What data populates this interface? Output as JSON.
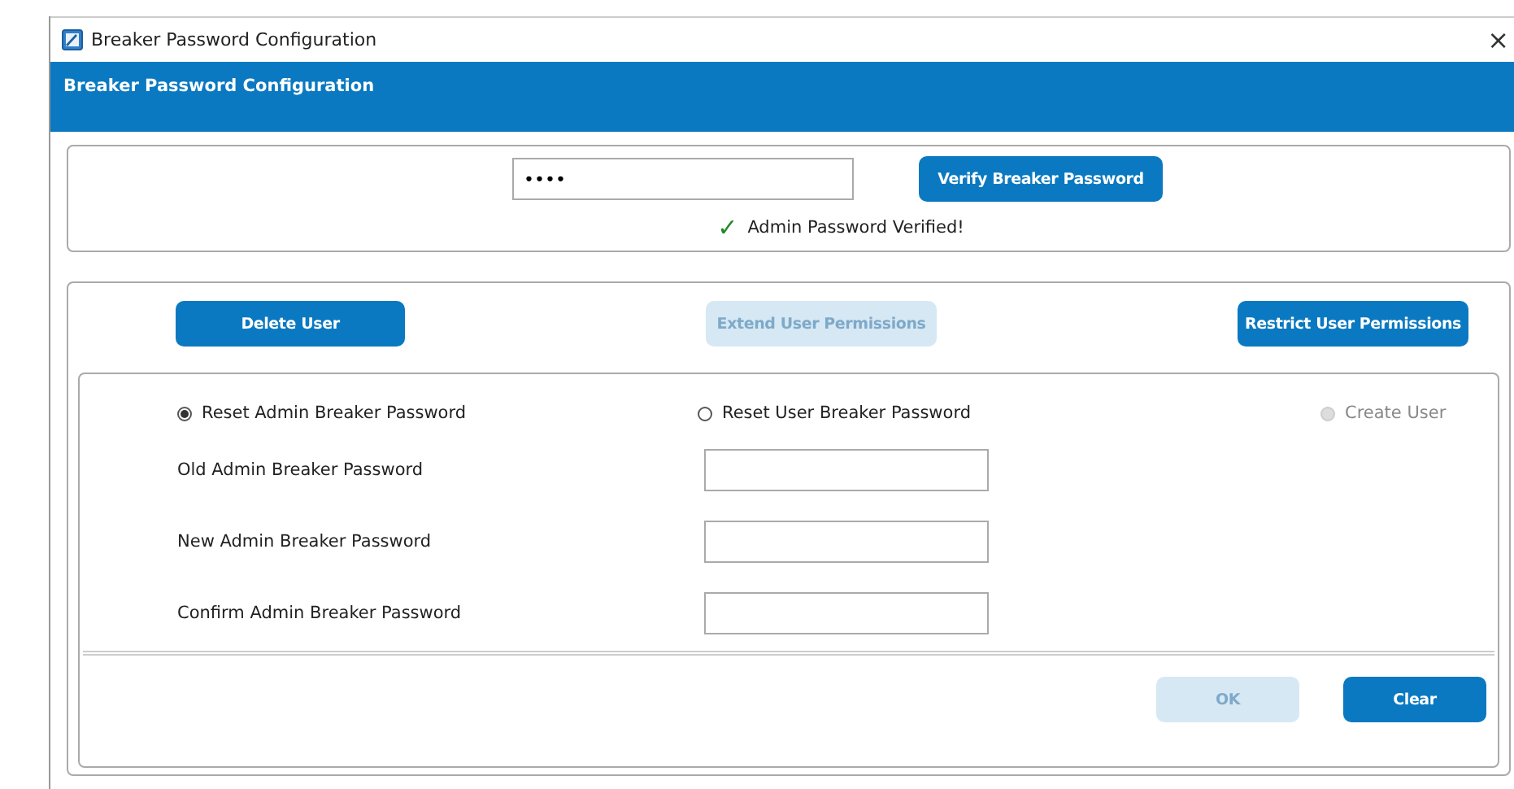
{
  "window": {
    "title": "Breaker Password Configuration",
    "close": "×"
  },
  "header": {
    "title": "Breaker Password Configuration"
  },
  "verify": {
    "password": {
      "value": "••••"
    },
    "button": {
      "label": "Verify Breaker Password",
      "disabled": false
    },
    "status": {
      "check": "✓",
      "text": "Admin Password Verified!"
    }
  },
  "actions": [
    {
      "label": "Delete User",
      "disabled": false
    },
    {
      "label": "Extend User Permissions",
      "disabled": true
    },
    {
      "label": "Restrict User Permissions",
      "disabled": false
    }
  ],
  "modes": [
    {
      "label": "Reset Admin Breaker Password",
      "selected": true,
      "disabled": false
    },
    {
      "label": "Reset User Breaker Password",
      "selected": false,
      "disabled": false
    },
    {
      "label": "Create User",
      "selected": false,
      "disabled": true
    }
  ],
  "fields": [
    {
      "label": "Old Admin Breaker Password"
    },
    {
      "label": "New Admin Breaker Password"
    },
    {
      "label": "Confirm Admin Breaker Password"
    }
  ],
  "footer": [
    {
      "label": "OK",
      "disabled": true
    },
    {
      "label": "Clear",
      "disabled": false
    }
  ]
}
